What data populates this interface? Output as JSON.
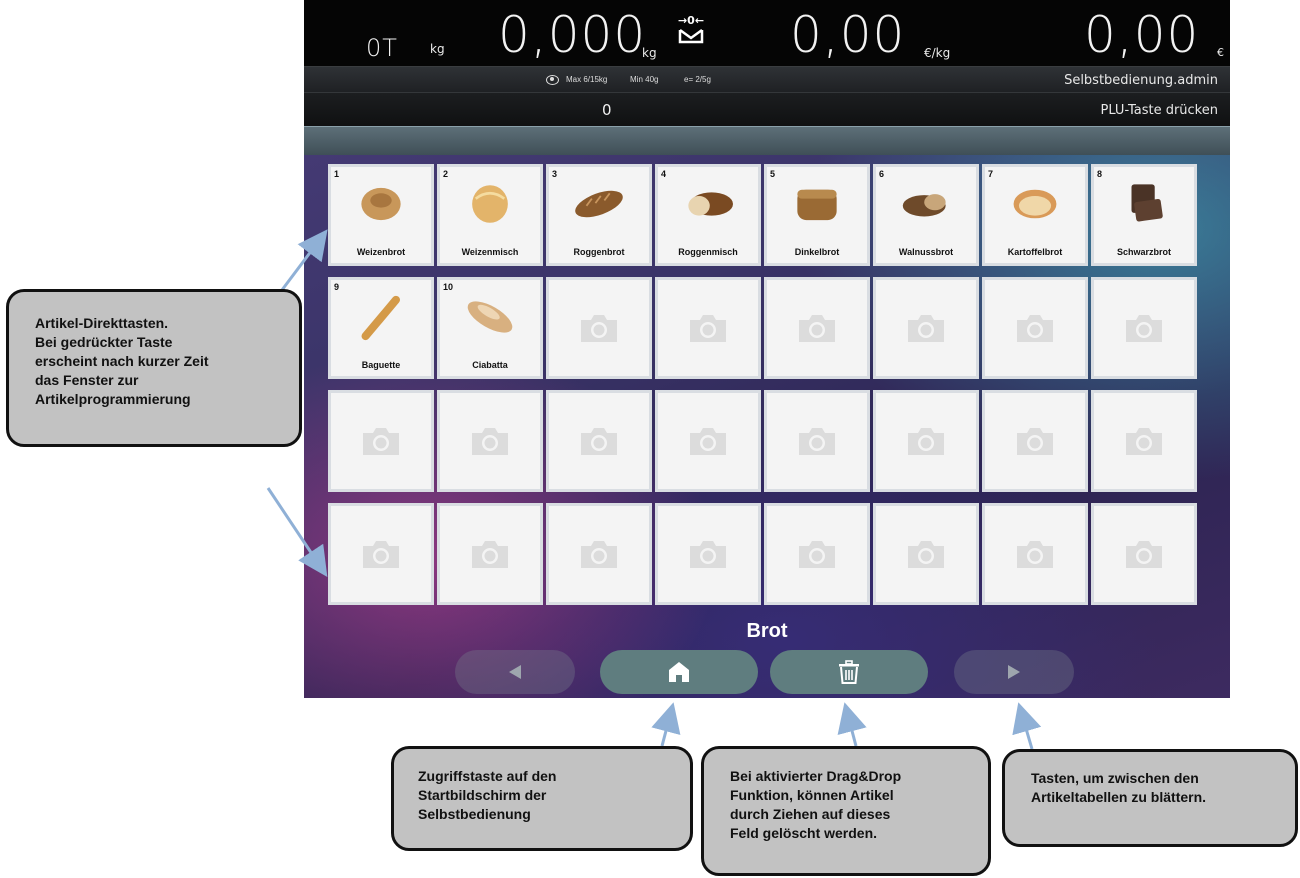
{
  "header": {
    "tare_value": "0T",
    "tare_unit": "kg",
    "weight_value": "0,000",
    "weight_unit": "kg",
    "unit_price_value": "0,00",
    "unit_price_unit": "€/kg",
    "total_value": "0,00",
    "total_unit": "€",
    "zero_icon": "zero-indicator-icon"
  },
  "info_bar": {
    "range_icon": "eye-icon",
    "max": "Max 6/15kg",
    "min": "Min 40g",
    "division": "e= 2/5g",
    "user": "Selbstbedienung.admin"
  },
  "status_bar": {
    "count": "0",
    "hint": "PLU-Taste drücken"
  },
  "articles": [
    {
      "num": "1",
      "label": "Weizenbrot",
      "icon": "round-bread-icon"
    },
    {
      "num": "2",
      "label": "Weizenmisch",
      "icon": "crusty-bread-icon"
    },
    {
      "num": "3",
      "label": "Roggenbrot",
      "icon": "long-loaf-icon"
    },
    {
      "num": "4",
      "label": "Roggenmisch",
      "icon": "sliced-loaf-icon"
    },
    {
      "num": "5",
      "label": "Dinkelbrot",
      "icon": "seeded-loaf-icon"
    },
    {
      "num": "6",
      "label": "Walnussbrot",
      "icon": "walnut-bread-icon"
    },
    {
      "num": "7",
      "label": "Kartoffelbrot",
      "icon": "cut-bread-icon"
    },
    {
      "num": "8",
      "label": "Schwarzbrot",
      "icon": "dark-bread-slices-icon"
    },
    {
      "num": "9",
      "label": "Baguette",
      "icon": "baguette-icon"
    },
    {
      "num": "10",
      "label": "Ciabatta",
      "icon": "ciabatta-icon"
    }
  ],
  "empty_slot_icon": "camera-placeholder-icon",
  "category": "Brot",
  "nav": {
    "prev_icon": "triangle-left-icon",
    "home_icon": "home-icon",
    "trash_icon": "trash-icon",
    "next_icon": "triangle-right-icon"
  },
  "callouts": {
    "article_keys": [
      "Artikel-Direkttasten.",
      "Bei gedrückter Taste",
      "erscheint nach kurzer Zeit",
      "das Fenster zur",
      "Artikelprogrammierung"
    ],
    "home": [
      "Zugriffstaste auf den",
      "Startbildschirm der",
      "Selbstbedienung"
    ],
    "trash": [
      "Bei aktivierter Drag&Drop",
      "Funktion, können Artikel",
      "durch Ziehen auf dieses",
      "Feld gelöscht werden."
    ],
    "paging": [
      "Tasten, um zwischen den",
      "Artikeltabellen zu blättern."
    ]
  },
  "colors": {
    "header_bg": "#050505",
    "nav_active": "#5f7d7f",
    "callout_bg": "#c2c2c2",
    "arrow": "#8fb0d6"
  }
}
